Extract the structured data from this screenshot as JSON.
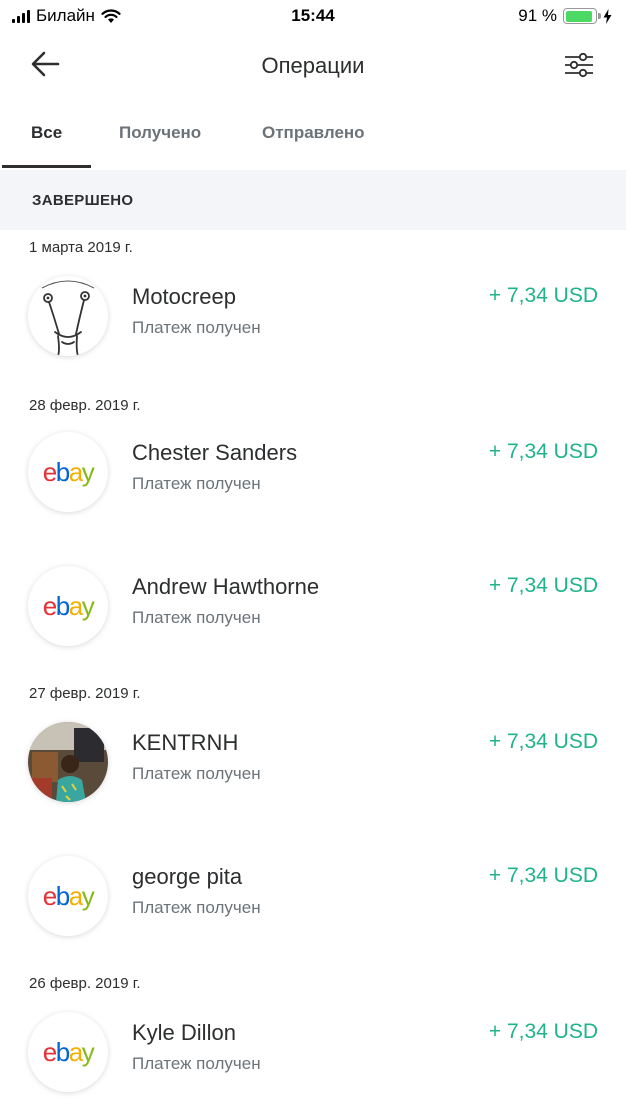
{
  "status_bar": {
    "carrier": "Билайн",
    "time": "15:44",
    "battery": "91 %",
    "battery_level": 0.91,
    "icons": [
      "signal-icon",
      "wifi-icon",
      "battery-icon",
      "charging-icon"
    ]
  },
  "header": {
    "title": "Операции",
    "back_icon": "arrow-left-icon",
    "filter_icon": "sliders-icon"
  },
  "tabs": [
    {
      "label": "Все",
      "active": true
    },
    {
      "label": "Получено",
      "active": false
    },
    {
      "label": "Отправлено",
      "active": false
    }
  ],
  "section": {
    "title": "ЗАВЕРШЕНО"
  },
  "dates": [
    "1 марта 2019 г.",
    "28 февр. 2019 г.",
    "27 февр. 2019 г.",
    "26 февр. 2019 г."
  ],
  "transactions": [
    {
      "name": "Motocreep",
      "status": "Платеж получен",
      "amount": "+ 7,34 USD",
      "avatar": "doodle-avatar"
    },
    {
      "name": "Chester Sanders",
      "status": "Платеж получен",
      "amount": "+ 7,34 USD",
      "avatar": "ebay-logo"
    },
    {
      "name": "Andrew Hawthorne",
      "status": "Платеж получен",
      "amount": "+ 7,34 USD",
      "avatar": "ebay-logo"
    },
    {
      "name": "KENTRNH",
      "status": "Платеж получен",
      "amount": "+ 7,34 USD",
      "avatar": "photo-avatar"
    },
    {
      "name": "george pita",
      "status": "Платеж получен",
      "amount": "+ 7,34 USD",
      "avatar": "ebay-logo"
    },
    {
      "name": "Kyle Dillon",
      "status": "Платеж получен",
      "amount": "+ 7,34 USD",
      "avatar": "ebay-logo"
    }
  ],
  "ebay_logo": {
    "e": "e",
    "b": "b",
    "a": "a",
    "y": "y"
  },
  "colors": {
    "accent_green": "#1fb38b",
    "text_primary": "#2c2e2f",
    "text_secondary": "#6c7378",
    "section_bg": "#f3f5f9",
    "ebay_red": "#e53238",
    "ebay_blue": "#0064d2",
    "ebay_yellow": "#f5af02",
    "ebay_green": "#86b817"
  }
}
